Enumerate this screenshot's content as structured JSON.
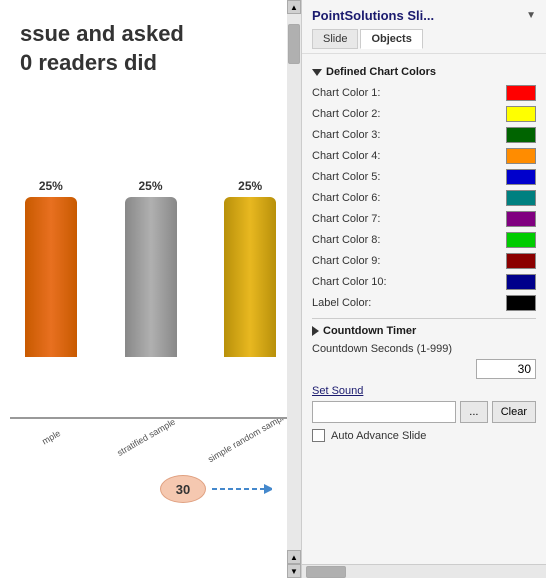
{
  "slide_preview": {
    "title_line1": "ssue and asked",
    "title_line2": "0 readers did",
    "bars": [
      {
        "label_top": "25%",
        "color": "orange",
        "caption": "mple"
      },
      {
        "label_top": "25%",
        "color": "gray",
        "caption": "stratified sample"
      },
      {
        "label_top": "25%",
        "color": "yellow",
        "caption": "simple random sample"
      }
    ],
    "bubble_value": "30"
  },
  "panel": {
    "title": "PointSolutions Sli...",
    "tabs": [
      {
        "label": "Slide",
        "active": false
      },
      {
        "label": "Objects",
        "active": true
      }
    ],
    "defined_chart_colors_header": "Defined Chart Colors",
    "colors": [
      {
        "label": "Chart Color 1:",
        "color": "#ff0000"
      },
      {
        "label": "Chart Color 2:",
        "color": "#ffff00"
      },
      {
        "label": "Chart Color 3:",
        "color": "#006400"
      },
      {
        "label": "Chart Color 4:",
        "color": "#ff8c00"
      },
      {
        "label": "Chart Color 5:",
        "color": "#0000cc"
      },
      {
        "label": "Chart Color 6:",
        "color": "#008080"
      },
      {
        "label": "Chart Color 7:",
        "color": "#800080"
      },
      {
        "label": "Chart Color 8:",
        "color": "#00cc00"
      },
      {
        "label": "Chart Color 9:",
        "color": "#8b0000"
      },
      {
        "label": "Chart Color 10:",
        "color": "#00008b"
      },
      {
        "label": "Label Color:",
        "color": "#000000"
      }
    ],
    "countdown_timer_header": "Countdown Timer",
    "countdown_seconds_label": "Countdown Seconds (1-999)",
    "countdown_value": "30",
    "set_sound_label": "Set Sound",
    "sound_value": "",
    "browse_btn_label": "...",
    "clear_btn_label": "Clear",
    "auto_advance_label": "Auto Advance Slide",
    "auto_advance_checked": false
  }
}
